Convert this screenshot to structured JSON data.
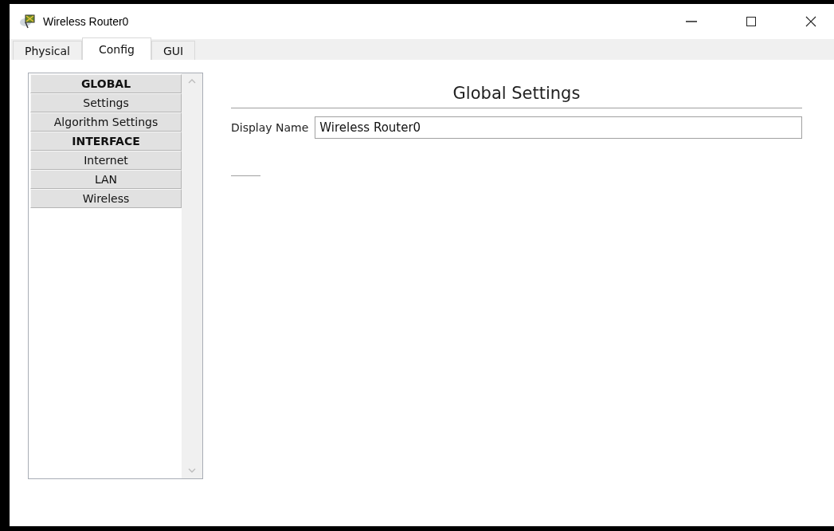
{
  "window": {
    "title": "Wireless Router0"
  },
  "tabs": [
    {
      "label": "Physical",
      "selected": false
    },
    {
      "label": "Config",
      "selected": true
    },
    {
      "label": "GUI",
      "selected": false
    }
  ],
  "sidebar": {
    "items": [
      {
        "label": "GLOBAL",
        "kind": "header"
      },
      {
        "label": "Settings",
        "kind": "item"
      },
      {
        "label": "Algorithm Settings",
        "kind": "item"
      },
      {
        "label": "INTERFACE",
        "kind": "header"
      },
      {
        "label": "Internet",
        "kind": "item"
      },
      {
        "label": "LAN",
        "kind": "item"
      },
      {
        "label": "Wireless",
        "kind": "item"
      }
    ]
  },
  "panel": {
    "heading": "Global Settings",
    "fields": [
      {
        "label": "Display Name",
        "value": "Wireless Router0"
      }
    ]
  }
}
